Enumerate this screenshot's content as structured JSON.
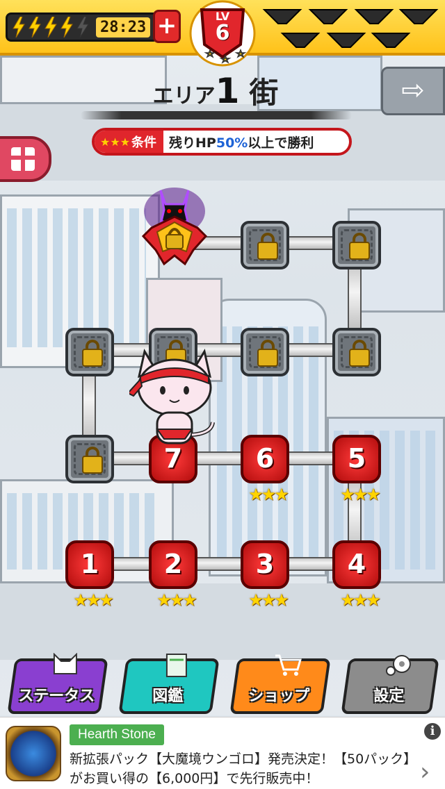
{
  "topbar": {
    "timer": "28:23",
    "plus": "+",
    "level_label": "LV",
    "level": "6"
  },
  "area": {
    "prefix": "エリア",
    "number": "1",
    "name": "街"
  },
  "condition": {
    "label": "条件",
    "text_before": "残りHP",
    "highlight": "50%",
    "text_after": "以上で勝利"
  },
  "stages": {
    "s1": "1",
    "s2": "2",
    "s3": "3",
    "s4": "4",
    "s5": "5",
    "s6": "6",
    "s7": "7",
    "stars": "★★★"
  },
  "menu": {
    "status": "ステータス",
    "zukan": "図鑑",
    "shop": "ショップ",
    "settings": "設定"
  },
  "ad": {
    "badge": "Hearth Stone",
    "line1": "新拡張パック【大魔境ウンゴロ】発売決定！【50パック】",
    "line2": "がお買い得の【6,000円】で先行販売中！",
    "info": "i",
    "chevron": "›"
  },
  "colors": {
    "topbar": "#ffc21a",
    "stage_red": "#d01414",
    "status_btn": "#8a3fd0",
    "zukan_btn": "#1fc7c0",
    "shop_btn": "#ff8a1a",
    "settings_btn": "#8c8c8c"
  }
}
